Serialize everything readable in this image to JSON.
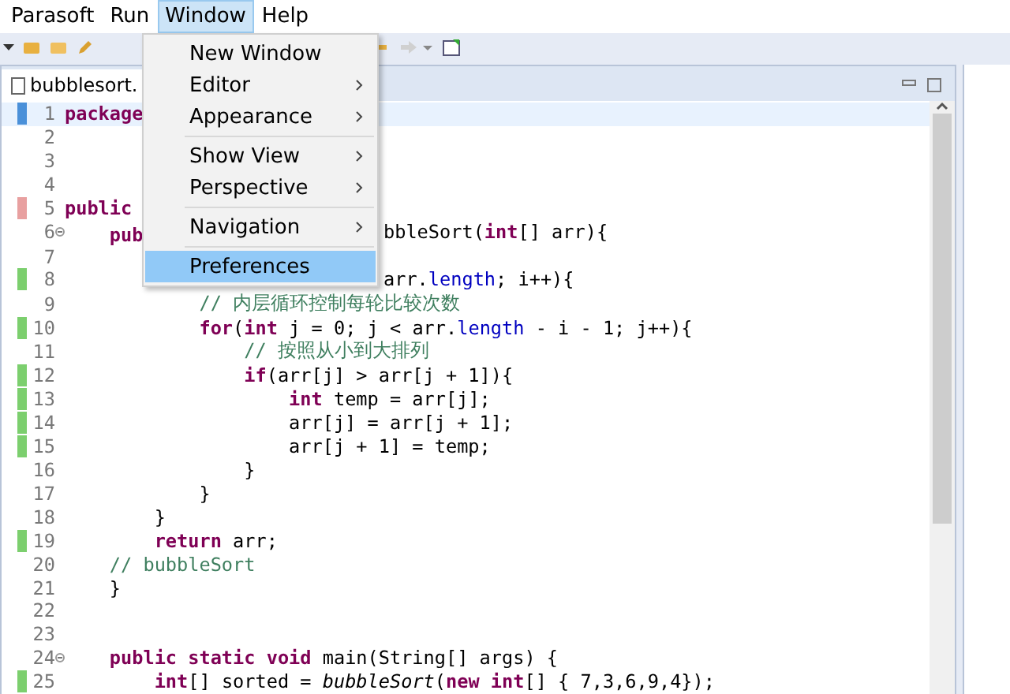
{
  "menu_bar": [
    {
      "label": "Parasoft",
      "selected": false
    },
    {
      "label": "Run",
      "selected": false
    },
    {
      "label": "Window",
      "selected": true
    },
    {
      "label": "Help",
      "selected": false
    }
  ],
  "window_menu": [
    {
      "label": "New Window",
      "submenu": false,
      "selected": false,
      "separator_before": false
    },
    {
      "label": "Editor",
      "submenu": true,
      "selected": false,
      "separator_before": false
    },
    {
      "label": "Appearance",
      "submenu": true,
      "selected": false,
      "separator_before": false
    },
    {
      "label": "Show View",
      "submenu": true,
      "selected": false,
      "separator_before": true
    },
    {
      "label": "Perspective",
      "submenu": true,
      "selected": false,
      "separator_before": false
    },
    {
      "label": "Navigation",
      "submenu": true,
      "selected": false,
      "separator_before": true
    },
    {
      "label": "Preferences",
      "submenu": false,
      "selected": true,
      "separator_before": true
    }
  ],
  "editor_tab": {
    "label": "bubblesort."
  },
  "lines": [
    {
      "number": "1",
      "current": true,
      "color": "#4a90d9",
      "left": [
        {
          "kind": "keyword",
          "text": "package"
        }
      ]
    },
    {
      "number": "2",
      "current": false
    },
    {
      "number": "3",
      "current": false
    },
    {
      "number": "4",
      "current": false
    },
    {
      "number": "5",
      "current": false,
      "color": "#e8a0a0",
      "left": [
        {
          "kind": "keyword",
          "text": "public"
        }
      ]
    },
    {
      "number": "6",
      "current": false,
      "fold": true,
      "left": [
        {
          "kind": "keyword",
          "text": "    pub"
        }
      ],
      "right": [
        {
          "kind": "plain",
          "text": "bbleSort("
        },
        {
          "kind": "keyword",
          "text": "int"
        },
        {
          "kind": "plain",
          "text": "[] arr){"
        }
      ]
    },
    {
      "number": "7",
      "current": false
    },
    {
      "number": "8",
      "current": false,
      "color": "#7ccf6e",
      "right": [
        {
          "kind": "plain",
          "text": "arr."
        },
        {
          "kind": "field",
          "text": "length"
        },
        {
          "kind": "plain",
          "text": "; i++){"
        }
      ]
    },
    {
      "number": "9",
      "current": false,
      "left": [
        {
          "kind": "comment",
          "text": "            // 内层循环控制每轮比较次数"
        }
      ]
    },
    {
      "number": "10",
      "current": false,
      "color": "#7ccf6e",
      "left": [
        {
          "kind": "keyword",
          "text": "            for"
        },
        {
          "kind": "plain",
          "text": "("
        },
        {
          "kind": "keyword",
          "text": "int"
        },
        {
          "kind": "plain",
          "text": " j = 0; j < arr."
        },
        {
          "kind": "field",
          "text": "length"
        },
        {
          "kind": "plain",
          "text": " - i - 1; j++){"
        }
      ]
    },
    {
      "number": "11",
      "current": false,
      "left": [
        {
          "kind": "comment",
          "text": "                // 按照从小到大排列"
        }
      ]
    },
    {
      "number": "12",
      "current": false,
      "color": "#7ccf6e",
      "left": [
        {
          "kind": "keyword",
          "text": "                if"
        },
        {
          "kind": "plain",
          "text": "(arr[j] > arr[j + 1]){"
        }
      ]
    },
    {
      "number": "13",
      "current": false,
      "color": "#7ccf6e",
      "left": [
        {
          "kind": "keyword",
          "text": "                    int"
        },
        {
          "kind": "plain",
          "text": " temp = arr[j];"
        }
      ]
    },
    {
      "number": "14",
      "current": false,
      "color": "#7ccf6e",
      "left": [
        {
          "kind": "plain",
          "text": "                    arr[j] = arr[j + 1];"
        }
      ]
    },
    {
      "number": "15",
      "current": false,
      "color": "#7ccf6e",
      "left": [
        {
          "kind": "plain",
          "text": "                    arr[j + 1] = temp;"
        }
      ]
    },
    {
      "number": "16",
      "current": false,
      "left": [
        {
          "kind": "plain",
          "text": "                }"
        }
      ]
    },
    {
      "number": "17",
      "current": false,
      "left": [
        {
          "kind": "plain",
          "text": "            }"
        }
      ]
    },
    {
      "number": "18",
      "current": false,
      "left": [
        {
          "kind": "plain",
          "text": "        }"
        }
      ]
    },
    {
      "number": "19",
      "current": false,
      "color": "#7ccf6e",
      "left": [
        {
          "kind": "keyword",
          "text": "        return"
        },
        {
          "kind": "plain",
          "text": " arr;"
        }
      ]
    },
    {
      "number": "20",
      "current": false,
      "left": [
        {
          "kind": "comment",
          "text": "    // bubbleSort"
        }
      ]
    },
    {
      "number": "21",
      "current": false,
      "left": [
        {
          "kind": "plain",
          "text": "    }"
        }
      ]
    },
    {
      "number": "22",
      "current": false
    },
    {
      "number": "23",
      "current": false
    },
    {
      "number": "24",
      "current": false,
      "fold": true,
      "left": [
        {
          "kind": "keyword",
          "text": "    public static void"
        },
        {
          "kind": "plain",
          "text": " main(String[] args) {"
        }
      ]
    },
    {
      "number": "25",
      "current": false,
      "color": "#7ccf6e",
      "left": [
        {
          "kind": "keyword",
          "text": "        int"
        },
        {
          "kind": "plain",
          "text": "[] sorted = "
        },
        {
          "kind": "static_call",
          "text": "bubbleSort"
        },
        {
          "kind": "plain",
          "text": "("
        },
        {
          "kind": "keyword",
          "text": "new int"
        },
        {
          "kind": "plain",
          "text": "[] { 7,3,6,9,4});"
        }
      ]
    }
  ]
}
